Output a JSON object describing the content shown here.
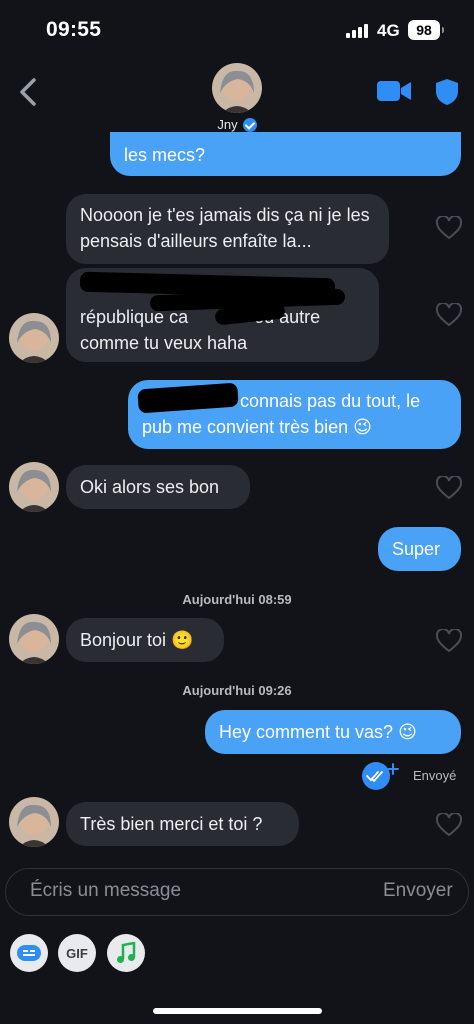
{
  "status": {
    "time": "09:55",
    "network": "4G",
    "battery": "98"
  },
  "header": {
    "name": "Jny"
  },
  "messages": {
    "m0": "les mecs?",
    "m1": "Noooon je t'es jamais dis ça ni je les pensais d'ailleurs enfaîte la...",
    "m2a": "république ca",
    "m2b": "ou autre",
    "m2c": "comme tu veux haha",
    "m3a": "connais pas du tout, le",
    "m3b": "pub me convient très bien 😉",
    "m4": "Oki alors ses bon",
    "m5": "Super",
    "ts1": "Aujourd'hui 08:59",
    "m6": "Bonjour toi 🙂",
    "ts2": "Aujourd'hui 09:26",
    "m7": "Hey comment tu vas? 😉",
    "sent": "Envoyé",
    "m8": "Très bien merci et toi ?"
  },
  "composer": {
    "placeholder": "Écris un message",
    "send": "Envoyer"
  },
  "toolbar": {
    "gif": "GIF"
  },
  "colors": {
    "background": "#111318",
    "outgoing": "#49a2f5",
    "incoming": "#2a2c33",
    "accent": "#2f8df6"
  },
  "icons": [
    "chevron-left-icon",
    "video-camera-icon",
    "shield-icon",
    "verified-badge-icon",
    "heart-icon",
    "read-receipt-icon",
    "sticker-icon",
    "music-note-icon"
  ]
}
